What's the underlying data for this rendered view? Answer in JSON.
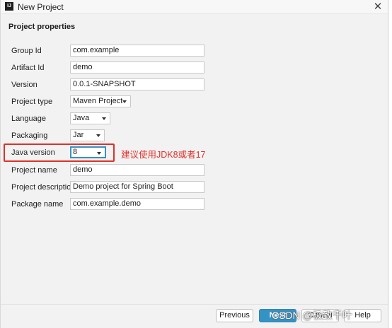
{
  "window": {
    "title": "New Project",
    "app_icon_text": "IJ"
  },
  "section": {
    "title": "Project properties"
  },
  "form": {
    "group_id": {
      "label": "Group Id",
      "value": "com.example"
    },
    "artifact_id": {
      "label": "Artifact Id",
      "value": "demo"
    },
    "version": {
      "label": "Version",
      "value": "0.0.1-SNAPSHOT"
    },
    "project_type": {
      "label": "Project type",
      "value": "Maven Project"
    },
    "language": {
      "label": "Language",
      "value": "Java"
    },
    "packaging": {
      "label": "Packaging",
      "value": "Jar"
    },
    "java_version": {
      "label": "Java version",
      "value": "8"
    },
    "project_name": {
      "label": "Project name",
      "value": "demo"
    },
    "project_description": {
      "label": "Project description",
      "value": "Demo project for Spring Boot"
    },
    "package_name": {
      "label": "Package name",
      "value": "com.example.demo"
    }
  },
  "annotation": {
    "text": "建议使用JDK8或者17",
    "color": "#e0302a"
  },
  "footer": {
    "previous_label": "Previous",
    "next_label": "Next",
    "cancel_label": "Cancel",
    "help_label": "Help"
  },
  "watermark": {
    "text": "CSDN @极致千叶"
  },
  "colors": {
    "accent": "#3592c4",
    "background": "#f2f2f2"
  },
  "icons": {
    "close": "close-icon",
    "dropdown": "chevron-down-icon",
    "app": "intellij-icon"
  }
}
